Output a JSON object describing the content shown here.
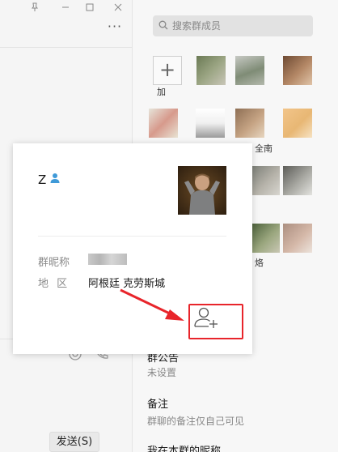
{
  "window": {
    "pin_icon": "pin-icon",
    "minimize_icon": "minimize-icon",
    "maximize_icon": "maximize-icon",
    "close_icon": "close-icon",
    "more_label": "···"
  },
  "chat": {
    "send_button": "发送(S)"
  },
  "members_panel": {
    "search_placeholder": "搜索群成员",
    "add_member_label": "+",
    "member_name_fragments": [
      "加",
      "全南",
      "烙"
    ],
    "settings": [
      {
        "title": "群公告",
        "value": "未设置"
      },
      {
        "title": "备注",
        "value": "群聊的备注仅自己可见"
      },
      {
        "title": "我在本群的昵称",
        "value": ""
      }
    ]
  },
  "profile_card": {
    "name": "Z",
    "gender_icon": "male-user-icon",
    "nickname_label": "群昵称",
    "region_label": "地  区",
    "region_value": "阿根廷 克劳斯城",
    "add_friend_icon": "add-user-icon"
  },
  "annotation": {
    "color": "#e8252b"
  }
}
